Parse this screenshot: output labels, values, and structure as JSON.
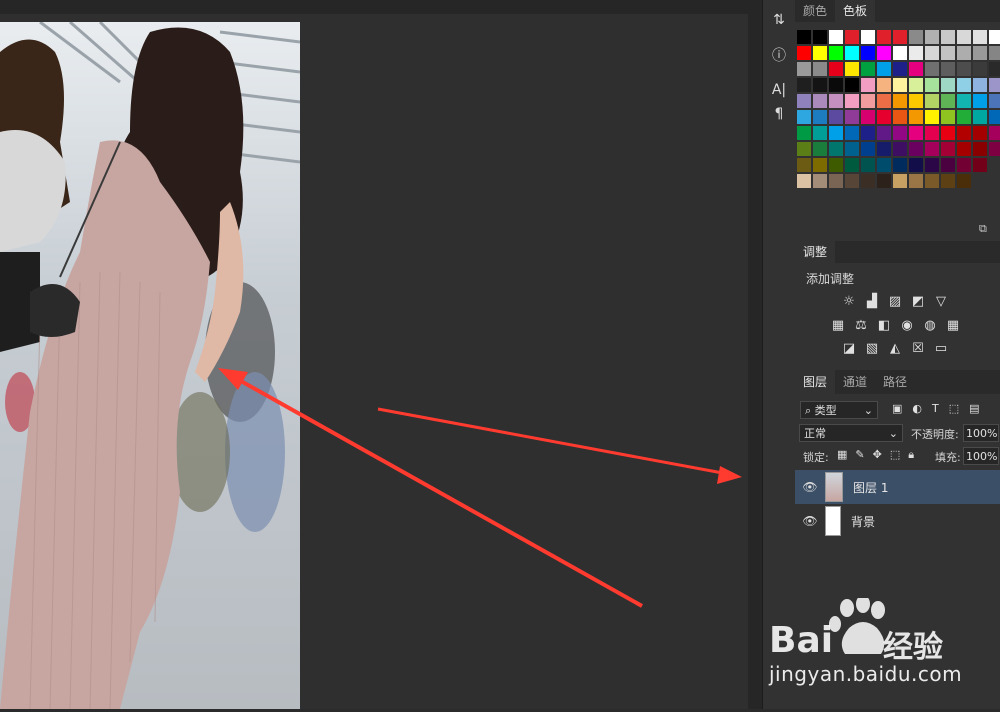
{
  "canvas": {
    "photo_desc": "photo-layer"
  },
  "rail": {
    "icons": [
      "history-icon",
      "info-icon",
      "character-icon",
      "paragraph-icon"
    ]
  },
  "color_panel": {
    "tabs": [
      {
        "label": "颜色",
        "active": false
      },
      {
        "label": "色板",
        "active": true
      }
    ]
  },
  "adjust_panel": {
    "tab": "调整",
    "title": "添加调整",
    "icons_row1": [
      "brightness-icon",
      "levels-icon",
      "curves-icon",
      "exposure-icon",
      "vibrance-icon"
    ],
    "icons_row2": [
      "hue-icon",
      "balance-icon",
      "bw-icon",
      "photo-filter-icon",
      "mixer-icon",
      "lookup-icon"
    ],
    "icons_row3": [
      "invert-icon",
      "posterize-icon",
      "threshold-icon",
      "selective-icon",
      "gradient-map-icon"
    ]
  },
  "layers_panel": {
    "tabs": [
      {
        "label": "图层",
        "active": true
      },
      {
        "label": "通道",
        "active": false
      },
      {
        "label": "路径",
        "active": false
      }
    ],
    "filter": "类型",
    "blend_mode": "正常",
    "opacity_label": "不透明度:",
    "opacity_value": "100%",
    "lock_label": "锁定:",
    "fill_label": "填充:",
    "fill_value": "100%",
    "layers": [
      {
        "name": "图层 1",
        "selected": true
      },
      {
        "name": "背景",
        "selected": false
      }
    ]
  },
  "watermark": {
    "brand": "Bai",
    "brand2": "经验",
    "url": "jingyan.baidu.com"
  },
  "colors": {
    "arrow": "#ff3b30",
    "selected_layer": "#3b4f66"
  }
}
